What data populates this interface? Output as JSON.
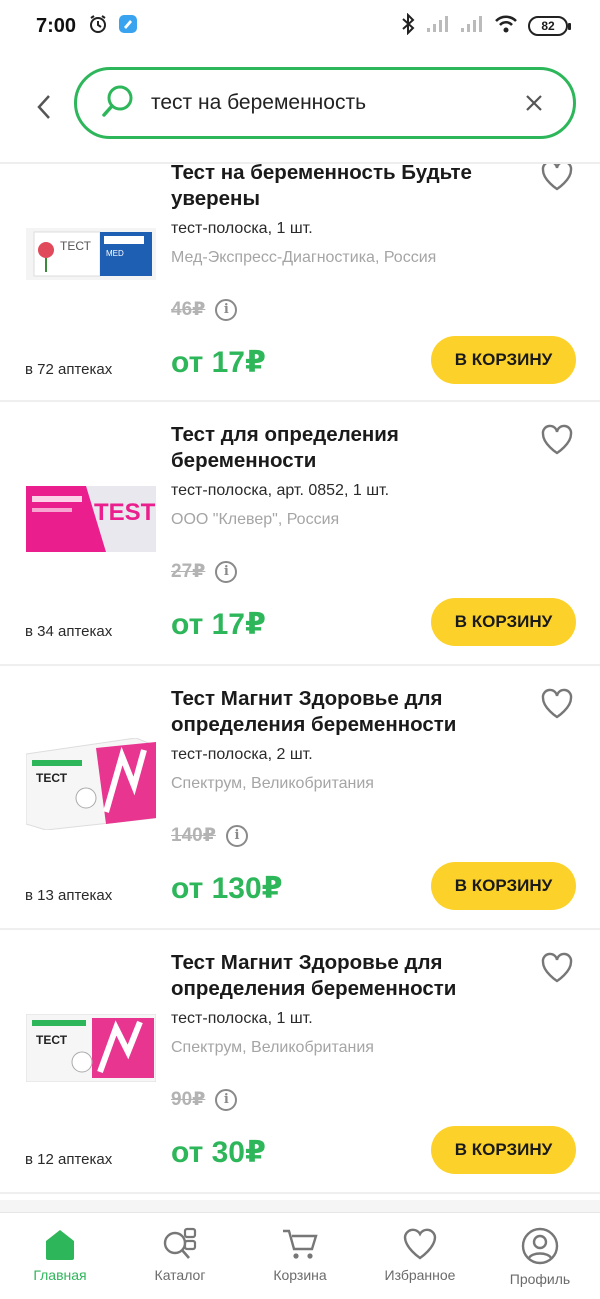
{
  "status_bar": {
    "time": "7:00",
    "battery": "82"
  },
  "search": {
    "query": "тест на беременность"
  },
  "products": [
    {
      "title": "Тест на беременность Будьте уверены",
      "subtitle": "тест-полоска, 1 шт.",
      "maker": "Мед-Экспресс-Диагностика, Россия",
      "old_price": "46₽",
      "price": "от 17₽",
      "pharmacies": "в 72 аптеках",
      "cart_label": "В КОРЗИНУ",
      "image_text": "ТЕСТ"
    },
    {
      "title": "Тест для определения беременности",
      "subtitle": "тест-полоска, арт. 0852, 1 шт.",
      "maker": "ООО \"Клевер\", Россия",
      "old_price": "27₽",
      "price": "от 17₽",
      "pharmacies": "в 34 аптеках",
      "cart_label": "В КОРЗИНУ",
      "image_text": "TEST"
    },
    {
      "title": "Тест Магнит Здоровье для определения беременности",
      "subtitle": "тест-полоска, 2 шт.",
      "maker": "Спектрум, Великобритания",
      "old_price": "140₽",
      "price": "от 130₽",
      "pharmacies": "в 13 аптеках",
      "cart_label": "В КОРЗИНУ",
      "image_text": "ТЕСТ"
    },
    {
      "title": "Тест Магнит Здоровье для определения беременности",
      "subtitle": "тест-полоска, 1 шт.",
      "maker": "Спектрум, Великобритания",
      "old_price": "90₽",
      "price": "от 30₽",
      "pharmacies": "в 12 аптеках",
      "cart_label": "В КОРЗИНУ",
      "image_text": "ТЕСТ"
    }
  ],
  "bottom_nav": [
    {
      "label": "Главная",
      "icon": "home-icon",
      "active": true
    },
    {
      "label": "Каталог",
      "icon": "catalog-icon",
      "active": false
    },
    {
      "label": "Корзина",
      "icon": "cart-icon",
      "active": false
    },
    {
      "label": "Избранное",
      "icon": "heart-icon",
      "active": false
    },
    {
      "label": "Профиль",
      "icon": "profile-icon",
      "active": false
    }
  ],
  "colors": {
    "accent_green": "#2eb65a",
    "button_yellow": "#fcd22a"
  }
}
